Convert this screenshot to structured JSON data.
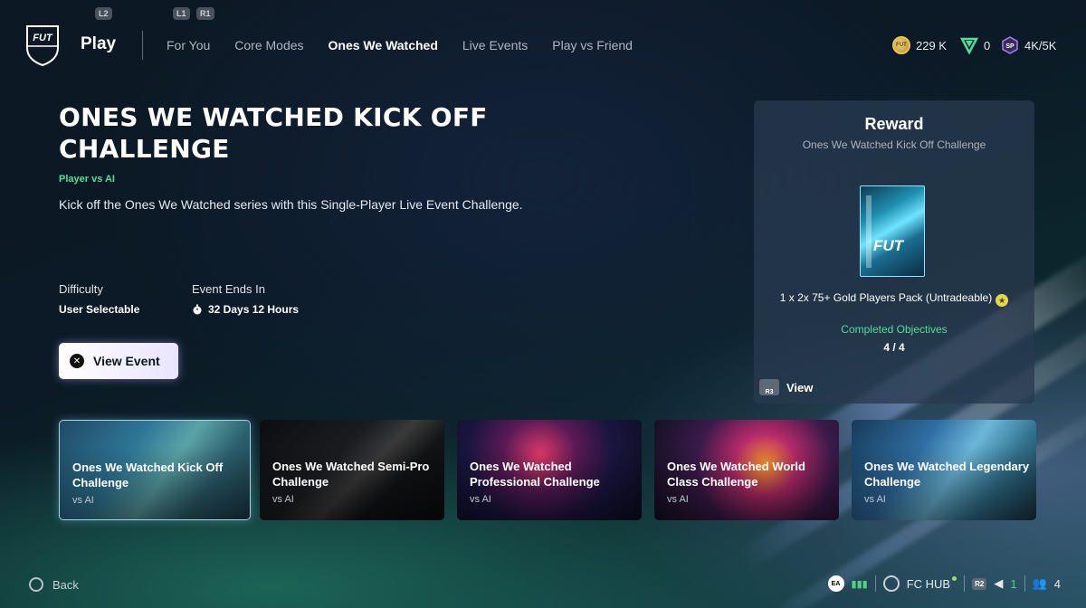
{
  "header": {
    "button_hints": [
      "L2",
      "L1",
      "R1"
    ],
    "logo_text": "FUT",
    "section_title": "Play",
    "tabs": [
      {
        "label": "For You",
        "active": false
      },
      {
        "label": "Core Modes",
        "active": false
      },
      {
        "label": "Ones We Watched",
        "active": true
      },
      {
        "label": "Live Events",
        "active": false
      },
      {
        "label": "Play vs Friend",
        "active": false
      }
    ],
    "currencies": {
      "coins": "229 K",
      "coin_icon_text": "FUT",
      "fc_points": "0",
      "sp_icon_text": "SP",
      "season_points": "4K/5K"
    }
  },
  "event": {
    "title": "ONES WE WATCHED KICK OFF CHALLENGE",
    "mode": "Player vs AI",
    "description": "Kick off the Ones We Watched series with this Single-Player Live Event Challenge.",
    "difficulty_label": "Difficulty",
    "difficulty_value": "User Selectable",
    "ends_label": "Event Ends In",
    "ends_value": "32 Days 12 Hours",
    "view_button_glyph": "✕",
    "view_button": "View Event"
  },
  "reward": {
    "title": "Reward",
    "subtitle": "Ones We Watched Kick Off Challenge",
    "pack_text": "FUT",
    "item": "1 x 2x 75+ Gold Players Pack (Untradeable)",
    "completed_label": "Completed Objectives",
    "completed_value": "4 / 4",
    "view_hint": "R3",
    "view_label": "View"
  },
  "challenges": [
    {
      "title": "Ones We Watched Kick Off Challenge",
      "sub": "vs AI",
      "selected": true
    },
    {
      "title": "Ones We Watched Semi-Pro Challenge",
      "sub": "vs AI",
      "selected": false
    },
    {
      "title": "Ones We Watched Professional Challenge",
      "sub": "vs AI",
      "selected": false
    },
    {
      "title": "Ones We Watched World Class Challenge",
      "sub": "vs AI",
      "selected": false
    },
    {
      "title": "Ones We Watched Legendary Challenge",
      "sub": "vs AI",
      "selected": false
    }
  ],
  "footer": {
    "back_label": "Back",
    "ea_text": "EA",
    "hub_label": "FC HUB",
    "r2_hint": "R2",
    "messages_count": "1",
    "friends_count": "4"
  }
}
